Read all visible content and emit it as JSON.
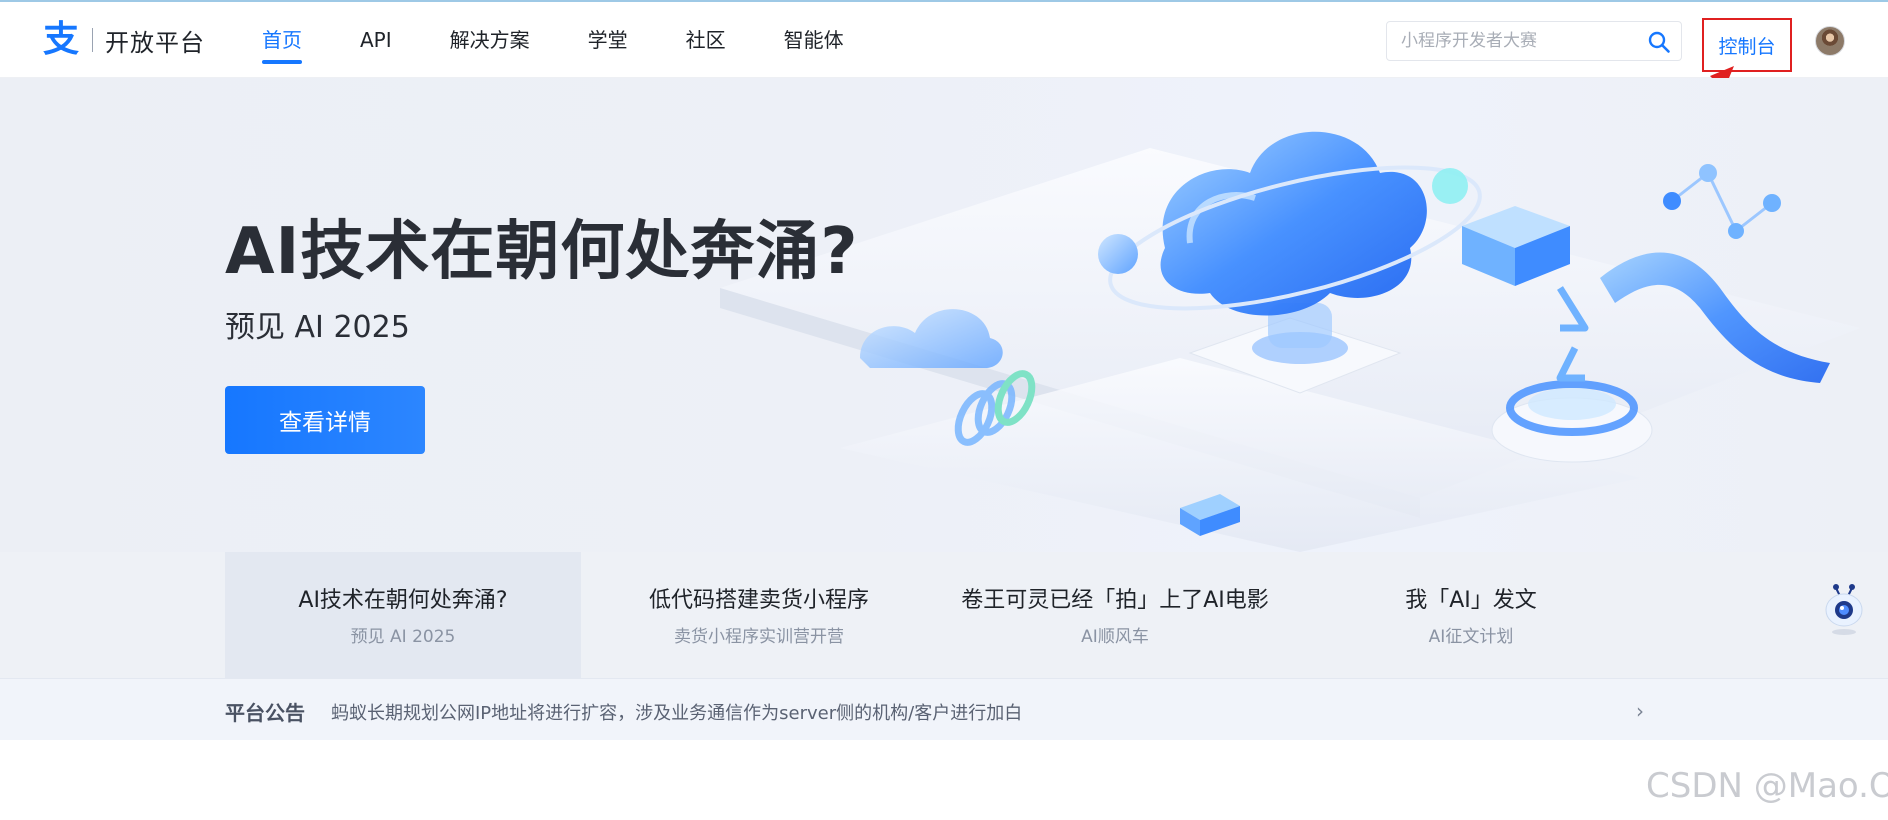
{
  "header": {
    "logo_icon": "alipay-logo",
    "brand": "开放平台",
    "nav": [
      {
        "label": "首页",
        "active": true
      },
      {
        "label": "API",
        "active": false
      },
      {
        "label": "解决方案",
        "active": false
      },
      {
        "label": "学堂",
        "active": false
      },
      {
        "label": "社区",
        "active": false
      },
      {
        "label": "智能体",
        "active": false
      }
    ],
    "search": {
      "placeholder": "小程序开发者大赛",
      "icon": "search-icon"
    },
    "console_label": "控制台",
    "avatar": "user-avatar"
  },
  "hero": {
    "title": "AI技术在朝何处奔涌?",
    "subtitle": "预见 AI 2025",
    "cta": "查看详情"
  },
  "features": [
    {
      "title": "AI技术在朝何处奔涌?",
      "subtitle": "预见 AI 2025",
      "active": true
    },
    {
      "title": "低代码搭建卖货小程序",
      "subtitle": "卖货小程序实训营开营",
      "active": false
    },
    {
      "title": "卷王可灵已经「拍」上了AI电影",
      "subtitle": "AI顺风车",
      "active": false
    },
    {
      "title": "我「AI」发文",
      "subtitle": "AI征文计划",
      "active": false
    }
  ],
  "announcement": {
    "label": "平台公告",
    "text": "蚂蚁长期规划公网IP地址将进行扩容，涉及业务通信作为server侧的机构/客户进行加白"
  },
  "watermark": "CSDN @Mao.O",
  "colors": {
    "accent": "#1677ff",
    "highlight_box": "#e02020"
  }
}
